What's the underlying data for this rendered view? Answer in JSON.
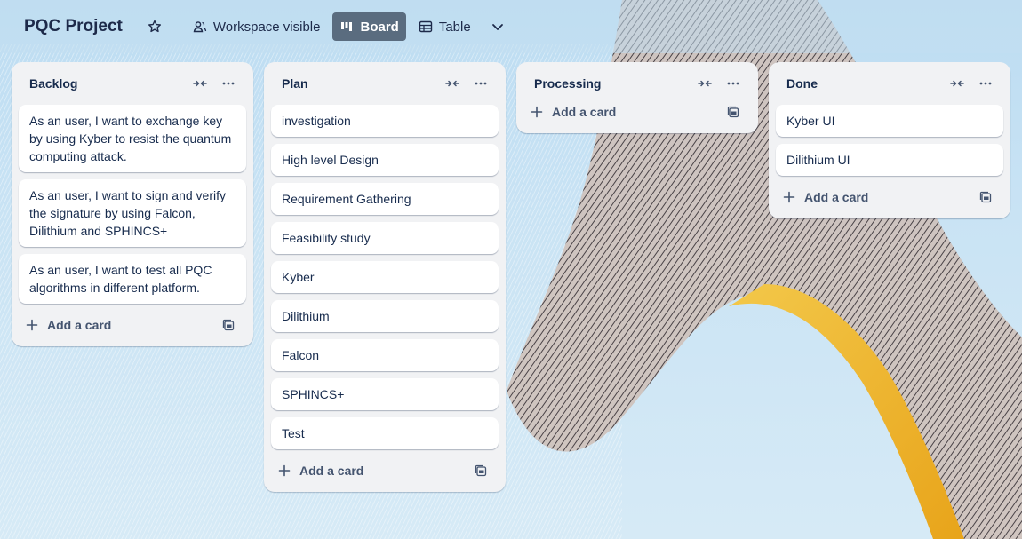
{
  "header": {
    "board_title": "PQC Project",
    "visibility_label": "Workspace visible",
    "views": [
      {
        "label": "Board",
        "active": true
      },
      {
        "label": "Table",
        "active": false
      }
    ]
  },
  "lists": [
    {
      "title": "Backlog",
      "cards": [
        "As an user, I want to exchange key by using Kyber to resist the quantum computing attack.",
        "As an user, I want to sign and verify the signature by using Falcon, Dilithium and SPHINCS+",
        "As an user, I want to test all PQC algorithms in different platform."
      ],
      "add_label": "Add a card"
    },
    {
      "title": "Plan",
      "cards": [
        "investigation",
        "High level Design",
        "Requirement Gathering",
        "Feasibility study",
        "Kyber",
        "Dilithium",
        "Falcon",
        "SPHINCS+",
        "Test"
      ],
      "add_label": "Add a card"
    },
    {
      "title": "Processing",
      "cards": [],
      "add_label": "Add a card"
    },
    {
      "title": "Done",
      "cards": [
        "Kyber UI",
        "Dilithium UI"
      ],
      "add_label": "Add a card"
    }
  ],
  "icons": {
    "star": "star-icon",
    "visibility": "people-icon",
    "board": "board-icon",
    "table": "table-icon",
    "more_views": "chevron-down-icon",
    "collapse": "collapse-icon",
    "menu": "more-icon",
    "add": "plus-icon",
    "template": "template-icon"
  },
  "colors": {
    "active_view_bg": "#5a6c7f",
    "list_bg": "#f1f2f4",
    "card_bg": "#ffffff",
    "text": "#172b4d"
  }
}
